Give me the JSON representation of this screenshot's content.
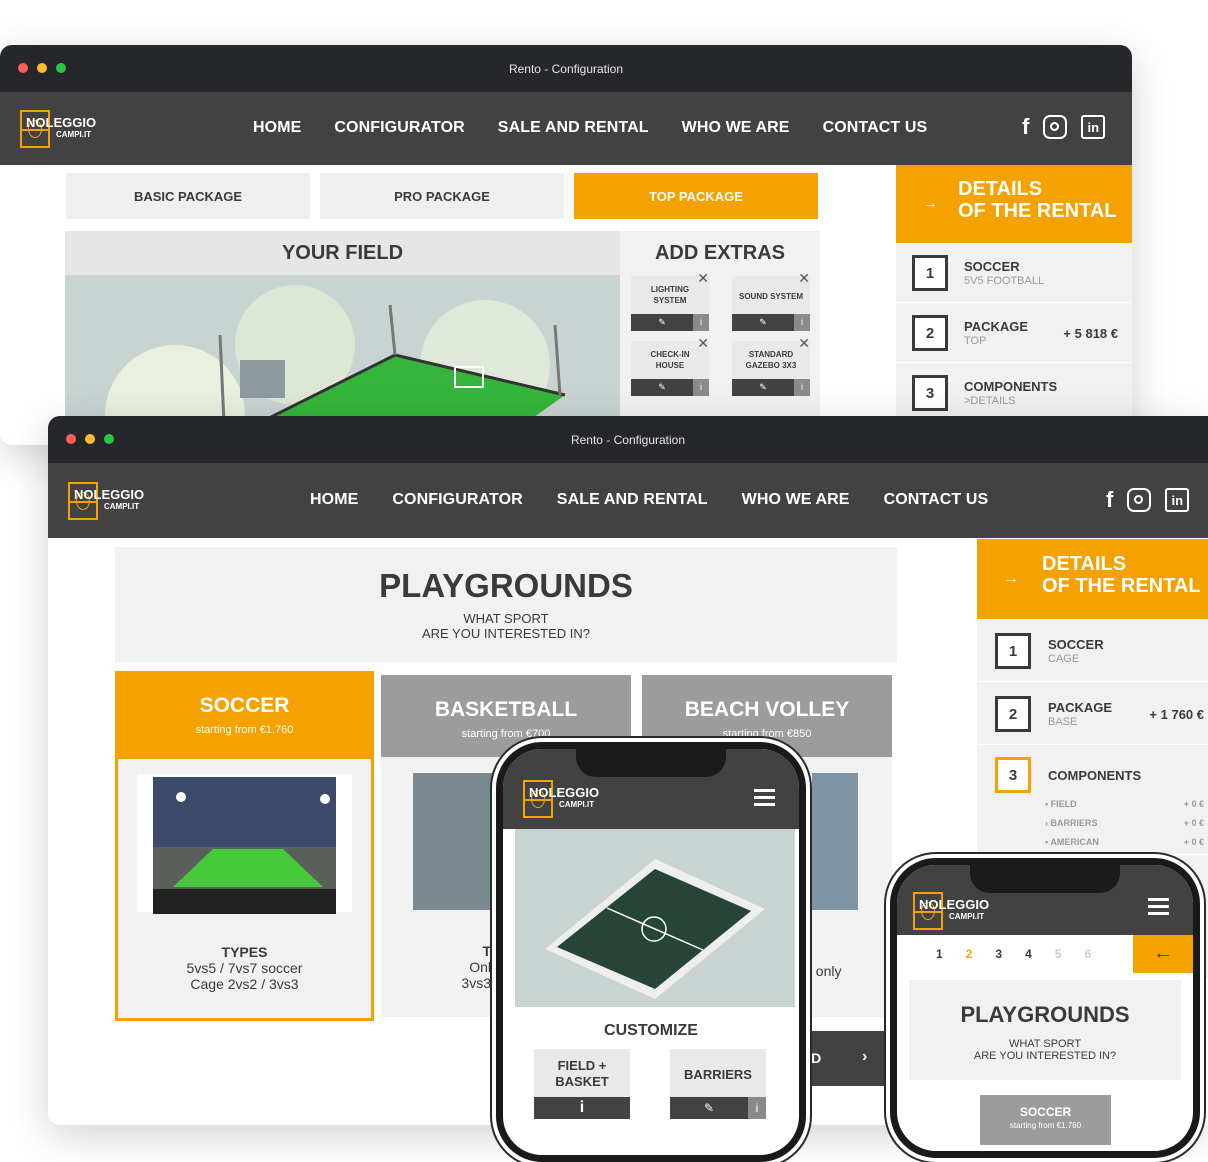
{
  "window": {
    "title": "Rento - Configuration"
  },
  "nav": {
    "logo_main": "NOLEGGIO",
    "logo_sub": "CAMPI.IT",
    "items": [
      "HOME",
      "CONFIGURATOR",
      "SALE AND RENTAL",
      "WHO WE ARE",
      "CONTACT US"
    ],
    "social": {
      "facebook": "f",
      "linkedin": "in"
    }
  },
  "back_window": {
    "packages": [
      "BASIC PACKAGE",
      "PRO PACKAGE",
      "TOP PACKAGE"
    ],
    "field_title": "YOUR FIELD",
    "extras_title": "ADD EXTRAS",
    "extras": [
      "LIGHTING SYSTEM",
      "SOUND SYSTEM",
      "CHECK-IN HOUSE",
      "STANDARD GAZEBO 3X3"
    ],
    "details": {
      "line1": "DETAILS",
      "line2": "OF THE RENTAL",
      "steps": [
        {
          "num": "1",
          "title": "SOCCER",
          "sub": "5V5 FOOTBALL",
          "price": ""
        },
        {
          "num": "2",
          "title": "PACKAGE",
          "sub": "TOP",
          "price": "+ 5 818 €"
        },
        {
          "num": "3",
          "title": "COMPONENTS",
          "sub": ">DETAILS",
          "price": ""
        }
      ]
    }
  },
  "front_window": {
    "heading": "PLAYGROUNDS",
    "question_line1": "WHAT SPORT",
    "question_line2": "ARE YOU INTERESTED IN?",
    "sports": [
      {
        "name": "SOCCER",
        "from": "starting from €1.760",
        "types_title": "TYPES",
        "types_line1": "5vs5 / 7vs7 soccer",
        "types_line2": "Cage 2vs2 / 3vs3"
      },
      {
        "name": "BASKETBALL",
        "from": "starting from €700",
        "types_title": "T",
        "types_line1": "Onl",
        "types_line2": "3vs3"
      },
      {
        "name": "BEACH VOLLEY",
        "from": "starting from €850",
        "types_title": "",
        "types_line1": "t only",
        "types_line2": ""
      }
    ],
    "read_btn": "AD",
    "details": {
      "line1": "DETAILS",
      "line2": "OF THE RENTAL",
      "steps": [
        {
          "num": "1",
          "title": "SOCCER",
          "sub": "CAGE",
          "price": ""
        },
        {
          "num": "2",
          "title": "PACKAGE",
          "sub": "BASE",
          "price": "+ 1 760 €"
        },
        {
          "num": "3",
          "title": "COMPONENTS",
          "sub": "",
          "price": ""
        }
      ],
      "components": [
        {
          "label": "• FIELD",
          "price": "+ 0 €"
        },
        {
          "label": "› BARRIERS",
          "price": "+ 0 €"
        },
        {
          "label": "• AMERICAN",
          "price": "+ 0 €"
        }
      ]
    }
  },
  "phone1": {
    "customize": "CUSTOMIZE",
    "options": [
      "FIELD + BASKET",
      "BARRIERS"
    ]
  },
  "phone2": {
    "steps": [
      "1",
      "2",
      "3",
      "4",
      "5",
      "6"
    ],
    "heading": "PLAYGROUNDS",
    "question_line1": "WHAT SPORT",
    "question_line2": "ARE YOU INTERESTED IN?",
    "sport_btn": "SOCCER",
    "sport_from": "starting from €1.760"
  },
  "colors": {
    "accent": "#f5a100",
    "nav": "#424242",
    "titlebar": "#25272a"
  }
}
